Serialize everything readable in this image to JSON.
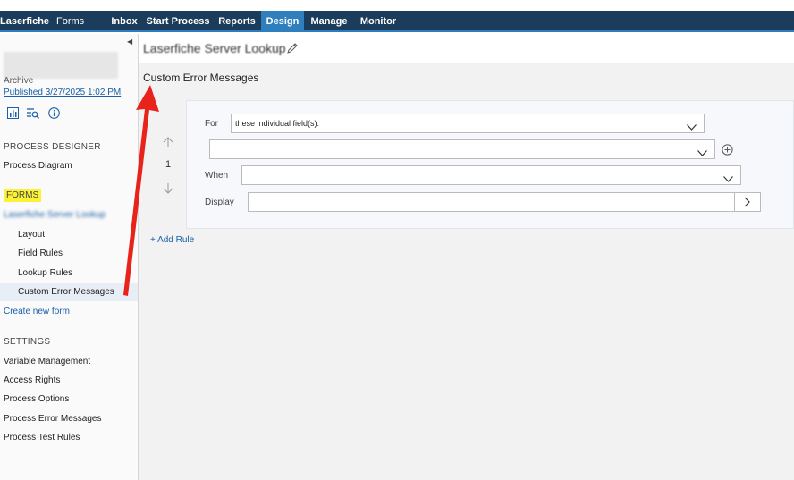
{
  "navbar": {
    "brand": "Laserfiche",
    "product": "Forms",
    "items": [
      {
        "label": "Inbox",
        "active": false
      },
      {
        "label": "Start Process",
        "active": false
      },
      {
        "label": "Reports",
        "active": false
      },
      {
        "label": "Design",
        "active": true
      },
      {
        "label": "Manage",
        "active": false
      },
      {
        "label": "Monitor",
        "active": false
      }
    ]
  },
  "sidebar": {
    "archive_label": "Archive",
    "published": "Published 3/27/2025 1:02 PM",
    "icons": [
      "chart-icon",
      "search-list-icon",
      "info-icon"
    ],
    "process_designer_heading": "PROCESS DESIGNER",
    "process_diagram": "Process Diagram",
    "forms_heading": "FORMS",
    "form_name": "Laserfiche Server Lookup",
    "form_subitems": [
      "Layout",
      "Field Rules",
      "Lookup Rules",
      "Custom Error Messages"
    ],
    "create_new_form": "Create new form",
    "settings_heading": "SETTINGS",
    "settings_items": [
      "Variable Management",
      "Access Rights",
      "Process Options",
      "Process Error Messages",
      "Process Test Rules"
    ]
  },
  "main": {
    "form_title": "Laserfiche Server Lookup",
    "page_heading": "Custom Error Messages",
    "rule": {
      "order": "1",
      "for_label": "For",
      "for_value": "these individual field(s):",
      "field_value": "",
      "when_label": "When",
      "when_value": "",
      "display_label": "Display",
      "display_value": ""
    },
    "add_rule": "+ Add Rule"
  },
  "colors": {
    "navbar": "#1b3c5a",
    "active_tab": "#2f7fbf",
    "link": "#1a5fa8",
    "highlight": "#fbf235",
    "annotation_arrow": "#e8231c"
  }
}
